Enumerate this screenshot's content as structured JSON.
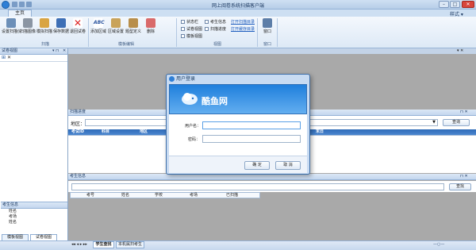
{
  "window": {
    "title": "网上阅卷系统扫描客户端",
    "min": "–",
    "max": "□",
    "close": "✕"
  },
  "tabs": {
    "home": "主页",
    "style": "样式 ▾"
  },
  "ribbon": {
    "groups": {
      "scan": "扫描",
      "template": "模板编辑",
      "view": "视图",
      "window": "窗口"
    },
    "scan_buttons": [
      "设置扫描仪",
      "扫描图像",
      "模拟扫描",
      "保存数据",
      "退回试卷"
    ],
    "template_buttons": [
      "添加区域",
      "区域设置",
      "题型定义",
      "删除"
    ],
    "view_checks": [
      "状态栏",
      "试卷视图",
      "模板视图",
      "考生信息",
      "扫描进度"
    ],
    "view_links": [
      "打开扫描目录",
      "打开缓存目录"
    ],
    "window_label": "窗口"
  },
  "left_pane": {
    "title": "试卷视图",
    "info_title": "考生信息",
    "info_fields": [
      "姓名",
      "考场",
      "姓名"
    ],
    "bottom_tabs": [
      "模板视图",
      "试卷视图"
    ]
  },
  "scan": {
    "title": "扫描进度",
    "region_label": "地区：",
    "query_button": "查询",
    "columns": [
      "考试ID",
      "科目",
      "地区",
      "末日"
    ]
  },
  "student": {
    "title": "考生信息",
    "search_button": "查找",
    "columns": [
      "考号",
      "姓名",
      "学校",
      "考场",
      "已扫描"
    ]
  },
  "status": {
    "tabs": [
      "学生查找",
      "本机属扫考生"
    ],
    "zoom": "—○—"
  },
  "dialog": {
    "title": "用户登录",
    "brand": "酷鱼网",
    "username_label": "用户名：",
    "password_label": "密码：",
    "username_value": "",
    "password_value": "",
    "ok": "确 定",
    "cancel": "取 消"
  }
}
